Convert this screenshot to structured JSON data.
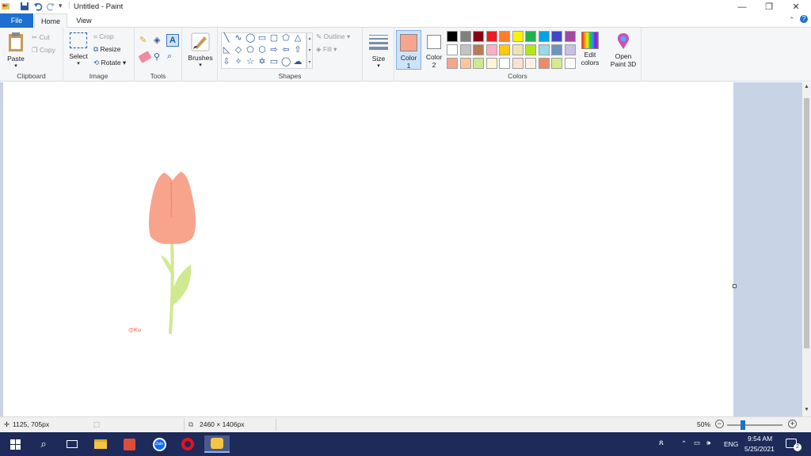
{
  "window": {
    "title": "Untitled - Paint"
  },
  "tabs": {
    "file": "File",
    "home": "Home",
    "view": "View"
  },
  "ribbon": {
    "clipboard": {
      "paste": "Paste",
      "cut": "Cut",
      "copy": "Copy",
      "label": "Clipboard"
    },
    "image": {
      "select": "Select",
      "crop": "Crop",
      "resize": "Resize",
      "rotate": "Rotate",
      "label": "Image"
    },
    "tools": {
      "label": "Tools"
    },
    "brushes": {
      "label": "Brushes"
    },
    "shapes": {
      "outline": "Outline",
      "fill": "Fill",
      "label": "Shapes"
    },
    "size": {
      "label": "Size"
    },
    "colors": {
      "color1": "Color",
      "color1_num": "1",
      "color2": "Color",
      "color2_num": "2",
      "edit": "Edit",
      "edit2": "colors",
      "label": "Colors",
      "color1_value": "#f7a58e",
      "color2_value": "#ffffff",
      "palette_row1": [
        "#000000",
        "#7f7f7f",
        "#880015",
        "#ed1c24",
        "#ff7f27",
        "#fff200",
        "#22b14c",
        "#00a2e8",
        "#3f48cc",
        "#a349a4"
      ],
      "palette_row2": [
        "#ffffff",
        "#c3c3c3",
        "#b97a57",
        "#ffaec9",
        "#ffc90e",
        "#efe4b0",
        "#b5e61d",
        "#99d9ea",
        "#7092be",
        "#c8bfe7"
      ],
      "palette_row3": [
        "#f7a58e",
        "#f9c79a",
        "#c9ea8e",
        "#fdf3d6",
        "#ffffff",
        "#fde0d0",
        "#fdf0e6",
        "#f28a66",
        "#d4ec8a",
        "#ffffff"
      ]
    },
    "paint3d": {
      "line1": "Open",
      "line2": "Paint 3D"
    }
  },
  "canvas": {
    "signature": "@Ku",
    "petal_color": "#f8a48d",
    "stem_color": "#cfe98f"
  },
  "status": {
    "cursor": "1125, 705px",
    "size": "2460 × 1406px",
    "zoom": "50%"
  },
  "taskbar": {
    "lang": "ENG",
    "time": "9:54 AM",
    "date": "5/25/2021",
    "notif_count": "2"
  }
}
